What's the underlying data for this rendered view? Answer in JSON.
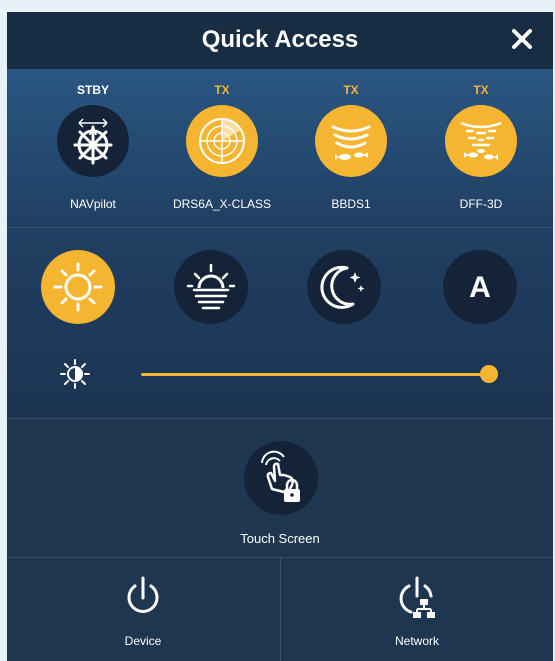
{
  "header": {
    "title": "Quick Access",
    "close_label": "×"
  },
  "devices": [
    {
      "status": "STBY",
      "status_color": "#ffffff",
      "name": "NAVpilot",
      "icon": "autopilot-wheel-icon",
      "active": false
    },
    {
      "status": "TX",
      "status_color": "#f5b530",
      "name": "DRS6A_X-CLASS",
      "icon": "radar-icon",
      "active": true
    },
    {
      "status": "TX",
      "status_color": "#f5b530",
      "name": "BBDS1",
      "icon": "sonar-icon",
      "active": true
    },
    {
      "status": "TX",
      "status_color": "#f5b530",
      "name": "DFF-3D",
      "icon": "sonar-3d-icon",
      "active": true
    }
  ],
  "display_modes": [
    {
      "icon": "sun-icon",
      "label": "Day",
      "selected": true
    },
    {
      "icon": "sunset-icon",
      "label": "Dusk",
      "selected": false
    },
    {
      "icon": "moon-icon",
      "label": "Night",
      "selected": false
    },
    {
      "icon": "auto-mode-icon",
      "label": "A",
      "selected": false
    }
  ],
  "brightness": {
    "icon": "brightness-icon",
    "level": 1.0
  },
  "touch": {
    "label": "Touch Screen",
    "icon": "touch-lock-icon"
  },
  "bottom": {
    "device_label": "Device",
    "network_label": "Network"
  },
  "colors": {
    "accent": "#f5b530",
    "panel": "#1f3650",
    "header": "#182c44",
    "icon_dark": "#142338"
  }
}
